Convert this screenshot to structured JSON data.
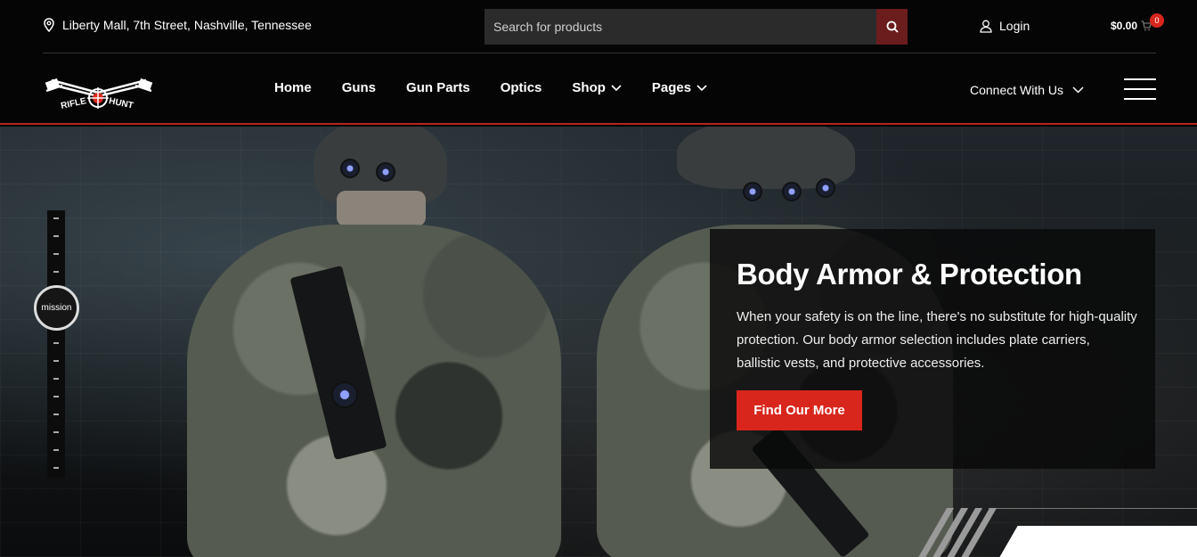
{
  "topbar": {
    "address": "Liberty Mall, 7th Street, Nashville, Tennessee",
    "search_placeholder": "Search for products",
    "login_label": "Login",
    "cart_total": "$0.00",
    "cart_count": "0"
  },
  "brand": {
    "logo_text_left": "RIFLE",
    "logo_text_right": "HUNT"
  },
  "nav": {
    "items": [
      {
        "label": "Home"
      },
      {
        "label": "Guns"
      },
      {
        "label": "Gun Parts"
      },
      {
        "label": "Optics"
      },
      {
        "label": "Shop"
      },
      {
        "label": "Pages"
      }
    ],
    "connect_label": "Connect With Us"
  },
  "hero": {
    "timeline_label": "mission",
    "title": "Body Armor & Protection",
    "description": "When your safety is on the line, there's no substitute for high-quality protection. Our body armor selection includes plate carriers, ballistic vests, and protective accessories.",
    "cta_label": "Find Our More"
  },
  "colors": {
    "accent": "#d9261c",
    "header_bg": "#050505",
    "search_bg": "#2b2b2b"
  },
  "icons": {
    "address": "map-pin-icon",
    "search": "search-icon",
    "login": "user-icon",
    "cart": "cart-icon",
    "menu": "hamburger-icon"
  }
}
